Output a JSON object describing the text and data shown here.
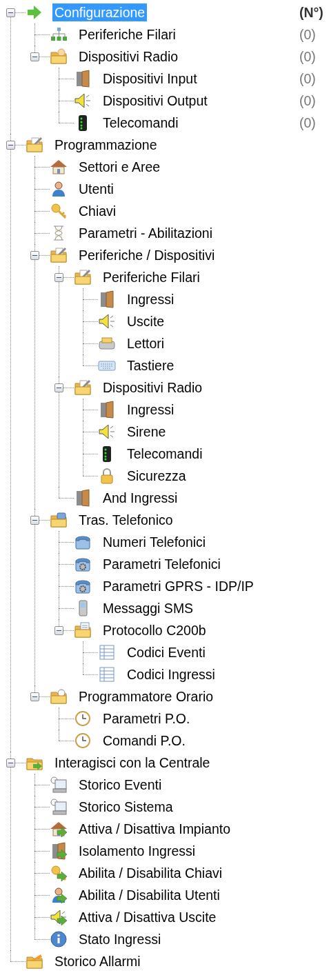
{
  "tree": [
    {
      "label": "Configurazione",
      "kind": "arrow",
      "selected": true,
      "expanded": true,
      "count": "(N°)",
      "children": [
        {
          "label": "Periferiche Filari",
          "kind": "network",
          "selected": false,
          "count": "(0)"
        },
        {
          "label": "Dispositivi Radio",
          "kind": "folder-note",
          "selected": false,
          "expanded": true,
          "count": "(0)",
          "children": [
            {
              "label": "Dispositivi Input",
              "kind": "door",
              "selected": false,
              "count": "(0)"
            },
            {
              "label": "Dispositivi Output",
              "kind": "speaker",
              "selected": false,
              "count": "(0)"
            },
            {
              "label": "Telecomandi",
              "kind": "remote",
              "selected": false,
              "count": "(0)"
            }
          ]
        }
      ]
    },
    {
      "label": "Programmazione",
      "kind": "folder-tool",
      "selected": false,
      "expanded": true,
      "children": [
        {
          "label": "Settori e Aree",
          "kind": "house",
          "selected": false
        },
        {
          "label": "Utenti",
          "kind": "user",
          "selected": false
        },
        {
          "label": "Chiavi",
          "kind": "key",
          "selected": false
        },
        {
          "label": "Parametri - Abilitazioni",
          "kind": "hourglass",
          "selected": false
        },
        {
          "label": "Periferiche / Dispositivi",
          "kind": "folder-tool",
          "selected": false,
          "expanded": true,
          "children": [
            {
              "label": "Periferiche Filari",
              "kind": "folder-tool",
              "selected": false,
              "expanded": true,
              "children": [
                {
                  "label": "Ingressi",
                  "kind": "door",
                  "selected": false
                },
                {
                  "label": "Uscite",
                  "kind": "speaker",
                  "selected": false
                },
                {
                  "label": "Lettori",
                  "kind": "reader",
                  "selected": false
                },
                {
                  "label": "Tastiere",
                  "kind": "keyboard",
                  "selected": false
                }
              ]
            },
            {
              "label": "Dispositivi Radio",
              "kind": "folder-tool",
              "selected": false,
              "expanded": true,
              "children": [
                {
                  "label": "Ingressi",
                  "kind": "door",
                  "selected": false
                },
                {
                  "label": "Sirene",
                  "kind": "speaker",
                  "selected": false
                },
                {
                  "label": "Telecomandi",
                  "kind": "remote",
                  "selected": false
                },
                {
                  "label": "Sicurezza",
                  "kind": "lock",
                  "selected": false
                }
              ]
            },
            {
              "label": "And Ingressi",
              "kind": "door",
              "selected": false
            }
          ]
        },
        {
          "label": "Tras. Telefonico",
          "kind": "folder-phone",
          "selected": false,
          "expanded": true,
          "children": [
            {
              "label": "Numeri Telefonici",
              "kind": "phone",
              "selected": false
            },
            {
              "label": "Parametri Telefonici",
              "kind": "phone-gear",
              "selected": false
            },
            {
              "label": "Parametri GPRS - IDP/IP",
              "kind": "phone-gear",
              "selected": false
            },
            {
              "label": "Messaggi SMS",
              "kind": "mobile",
              "selected": false
            },
            {
              "label": "Protocollo C200b",
              "kind": "folder-doc",
              "selected": false,
              "expanded": true,
              "children": [
                {
                  "label": "Codici Eventi",
                  "kind": "table",
                  "selected": false
                },
                {
                  "label": "Codici Ingressi",
                  "kind": "table",
                  "selected": false
                }
              ]
            }
          ]
        },
        {
          "label": "Programmatore Orario",
          "kind": "folder-clock",
          "selected": false,
          "expanded": true,
          "children": [
            {
              "label": "Parametri P.O.",
              "kind": "clock",
              "selected": false
            },
            {
              "label": "Comandi P.O.",
              "kind": "clock",
              "selected": false
            }
          ]
        }
      ]
    },
    {
      "label": "Interagisci con la Centrale",
      "kind": "folder-arrow",
      "selected": false,
      "expanded": true,
      "children": [
        {
          "label": "Storico Eventi",
          "kind": "monitor",
          "selected": false
        },
        {
          "label": "Storico Sistema",
          "kind": "monitor",
          "selected": false
        },
        {
          "label": "Attiva / Disattiva Impianto",
          "kind": "house-arrow",
          "selected": false
        },
        {
          "label": "Isolamento Ingressi",
          "kind": "door-arrow",
          "selected": false
        },
        {
          "label": "Abilita / Disabilita Chiavi",
          "kind": "key-arrow",
          "selected": false
        },
        {
          "label": "Abilita / Disabilita Utenti",
          "kind": "user-arrow",
          "selected": false
        },
        {
          "label": "Attiva / Disattiva Uscite",
          "kind": "speaker-arrow",
          "selected": false
        },
        {
          "label": "Stato Ingressi",
          "kind": "info",
          "selected": false
        }
      ]
    },
    {
      "label": "Storico Allarmi",
      "kind": "folder-alarm",
      "selected": false
    }
  ]
}
